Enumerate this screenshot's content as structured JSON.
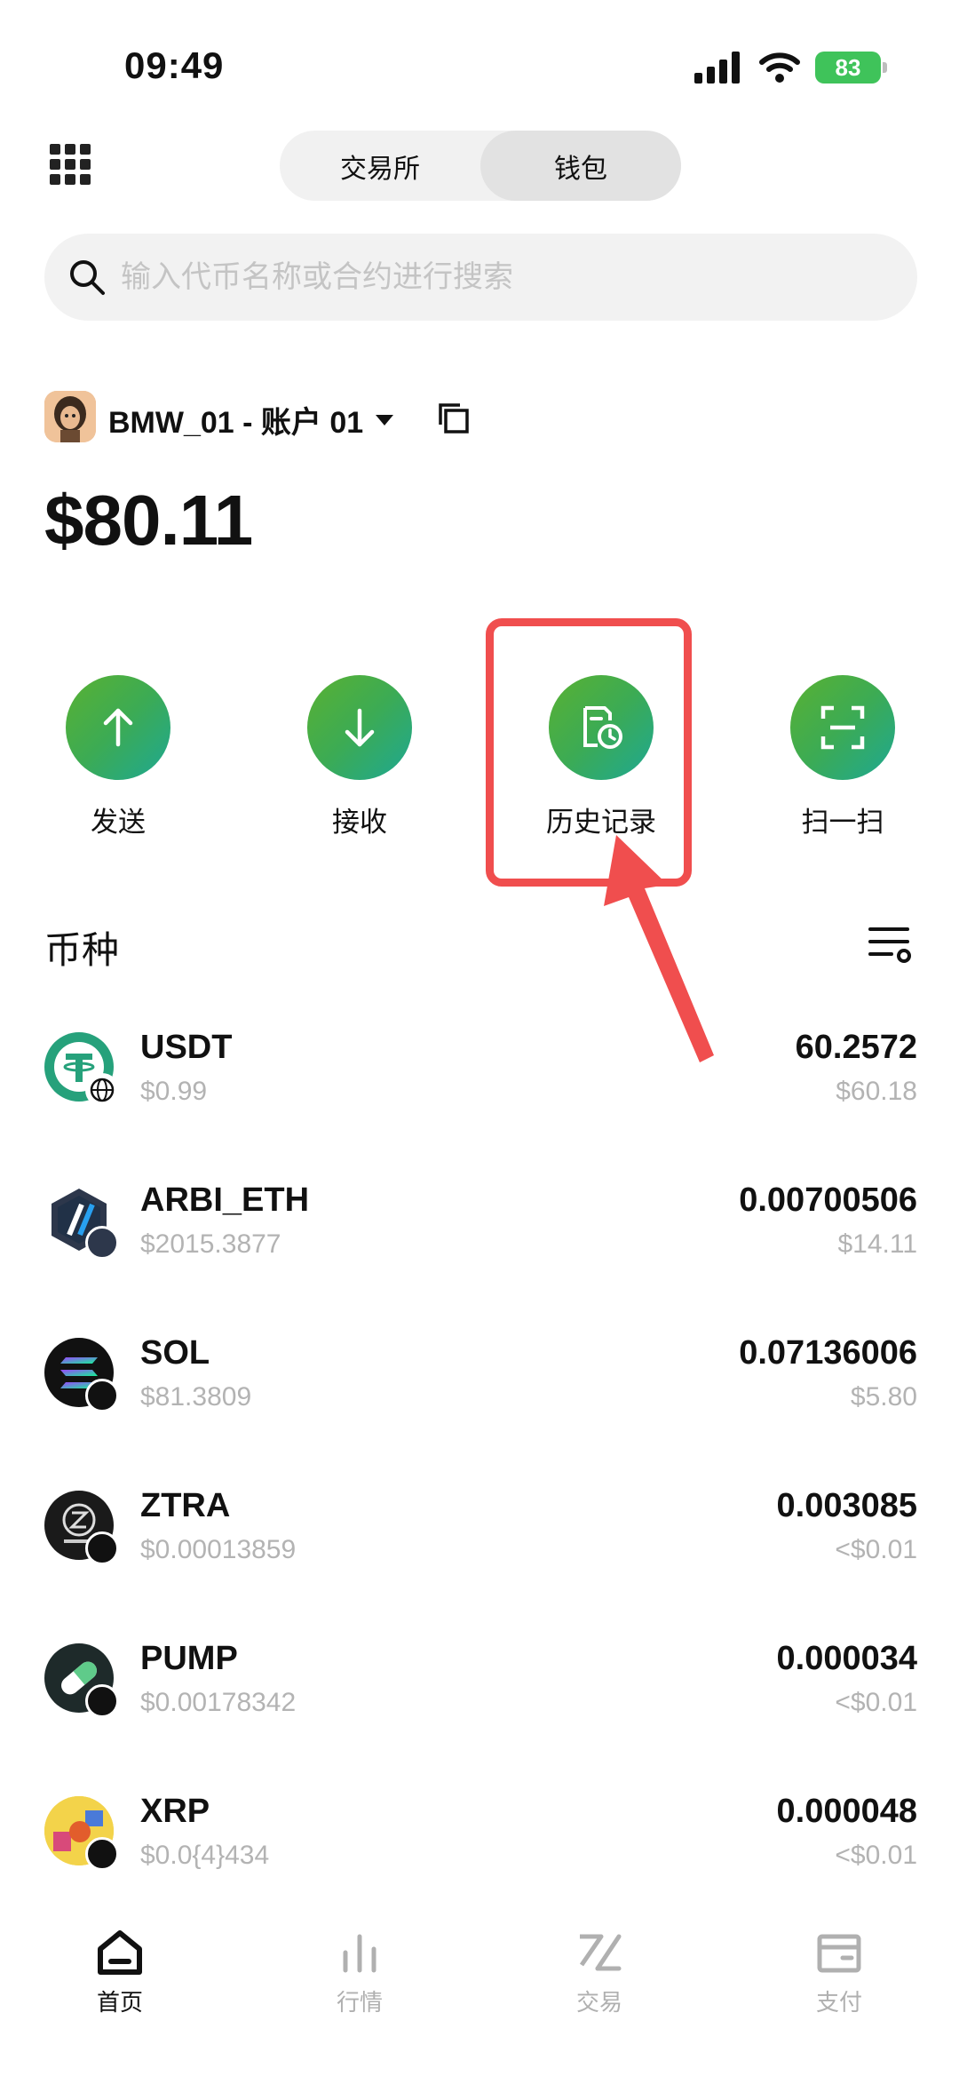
{
  "status_bar": {
    "time": "09:49",
    "battery": "83"
  },
  "header": {
    "tabs": [
      {
        "label": "交易所",
        "active": false
      },
      {
        "label": "钱包",
        "active": true
      }
    ]
  },
  "search": {
    "placeholder": "输入代币名称或合约进行搜索"
  },
  "account": {
    "name": "BMW_01 - 账户 01",
    "balance": "$80.11"
  },
  "actions": [
    {
      "label": "发送",
      "icon": "arrow-up-icon"
    },
    {
      "label": "接收",
      "icon": "arrow-down-icon"
    },
    {
      "label": "历史记录",
      "icon": "history-icon"
    },
    {
      "label": "扫一扫",
      "icon": "scan-icon"
    }
  ],
  "tokens_section": {
    "title": "币种"
  },
  "tokens": [
    {
      "name": "USDT",
      "price": "$0.99",
      "amount": "60.2572",
      "value": "$60.18",
      "color": "#26a17b"
    },
    {
      "name": "ARBI_ETH",
      "price": "$2015.3877",
      "amount": "0.00700506",
      "value": "$14.11",
      "color": "#2d374b"
    },
    {
      "name": "SOL",
      "price": "$81.3809",
      "amount": "0.07136006",
      "value": "$5.80",
      "color": "#111111"
    },
    {
      "name": "ZTRA",
      "price": "$0.00013859",
      "amount": "0.003085",
      "value": "<$0.01",
      "color": "#1a1a1a"
    },
    {
      "name": "PUMP",
      "price": "$0.00178342",
      "amount": "0.000034",
      "value": "<$0.01",
      "color": "#1e2a2a"
    },
    {
      "name": "XRP",
      "price": "$0.0{4}434",
      "amount": "0.000048",
      "value": "<$0.01",
      "color": "#d84a7a"
    }
  ],
  "bottom_nav": [
    {
      "label": "首页",
      "active": true
    },
    {
      "label": "行情",
      "active": false
    },
    {
      "label": "交易",
      "active": false
    },
    {
      "label": "支付",
      "active": false
    }
  ],
  "colors": {
    "accent_green": "#3cab54",
    "highlight_red": "#f04e4e",
    "muted_text": "#b3b3b3"
  }
}
